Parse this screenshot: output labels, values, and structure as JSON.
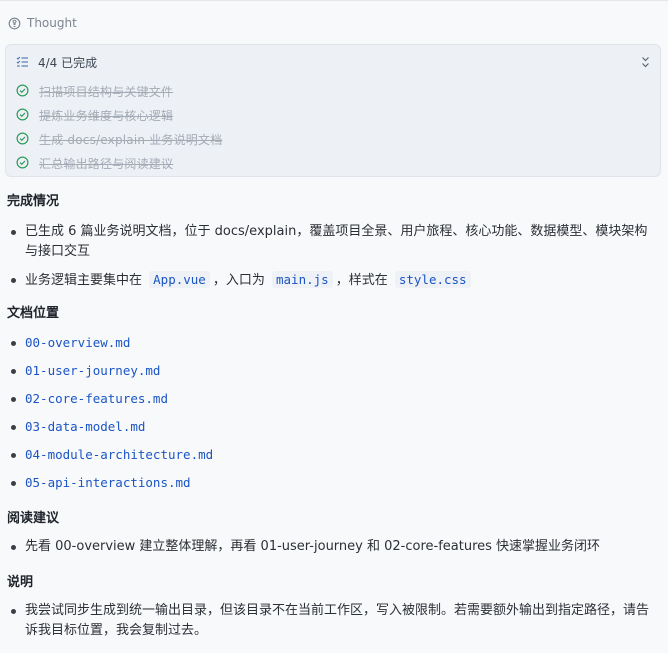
{
  "thought": {
    "label": "Thought"
  },
  "todo": {
    "progress": "4/4 已完成",
    "items": [
      {
        "label": "扫描项目结构与关键文件",
        "done": true
      },
      {
        "label": "提炼业务维度与核心逻辑",
        "done": true
      },
      {
        "label": "生成 docs/explain 业务说明文档",
        "done": true
      },
      {
        "label": "汇总输出路径与阅读建议",
        "done": true
      }
    ]
  },
  "sections": {
    "completion": {
      "title": "完成情况",
      "item1": "已生成 6 篇业务说明文档，位于 docs/explain，覆盖项目全景、用户旅程、核心功能、数据模型、模块架构与接口交互",
      "item2_pre": "业务逻辑主要集中在",
      "item2_code1": "App.vue",
      "item2_mid": "，入口为",
      "item2_code2": "main.js",
      "item2_mid2": "，样式在",
      "item2_code3": "style.css"
    },
    "docs": {
      "title": "文档位置",
      "files": [
        "00-overview.md",
        "01-user-journey.md",
        "02-core-features.md",
        "03-data-model.md",
        "04-module-architecture.md",
        "05-api-interactions.md"
      ]
    },
    "reading": {
      "title": "阅读建议",
      "item1": "先看 00-overview 建立整体理解，再看 01-user-journey 和 02-core-features 快速掌握业务闭环"
    },
    "notes": {
      "title": "说明",
      "item1": "我尝试同步生成到统一输出目录，但该目录不在当前工作区，写入被限制。若需要额外输出到指定路径，请告诉我目标位置，我会复制过去。"
    }
  },
  "colors": {
    "accent": "#1b55c4",
    "check": "#2e9b5b",
    "muted": "#a3abb6"
  }
}
